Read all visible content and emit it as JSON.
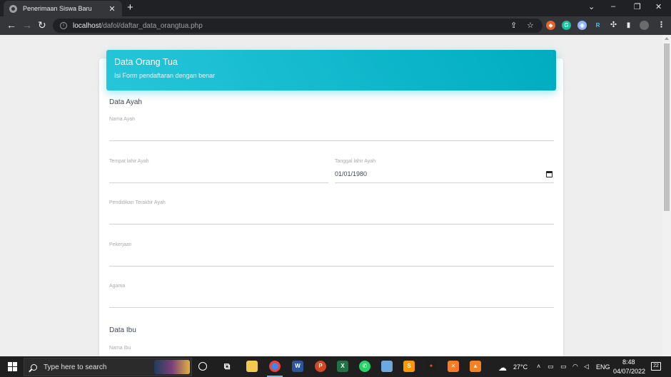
{
  "browser": {
    "tab_title": "Penerimaan Siswa Baru",
    "tab_close": "✕",
    "new_tab": "+",
    "url_host": "localhost",
    "url_path": "/dafol/daftar_data_orangtua.php",
    "window_controls": {
      "minimize": "⌄",
      "min": "–",
      "restore": "❐",
      "close": "✕"
    },
    "extensions": [
      "G",
      "R"
    ]
  },
  "form": {
    "header_title": "Data Orang Tua",
    "header_subtitle": "Isi Form pendaftaran dengan benar",
    "section_father": "Data Ayah",
    "father_name_label": "Nama Ayah",
    "father_birthplace_label": "Tempat lahir Ayah",
    "father_birthdate_label": "Tanggal lahir Ayah",
    "father_birthdate_value": "01/01/1980",
    "father_education_label": "Pendidikan Terakhir Ayah",
    "father_job_label": "Pekerjaan",
    "father_religion_label": "Agama",
    "section_mother": "Data Ibu",
    "mother_name_label": "Nama Ibu"
  },
  "taskbar": {
    "search_placeholder": "Type here to search",
    "temperature": "27°C",
    "language": "ENG",
    "time": "8:48",
    "date": "04/07/2022",
    "notification_count": "22"
  },
  "colors": {
    "header_accent": "#00bcd4",
    "browser_dark": "#202124",
    "taskbar": "#1f1f1f"
  }
}
